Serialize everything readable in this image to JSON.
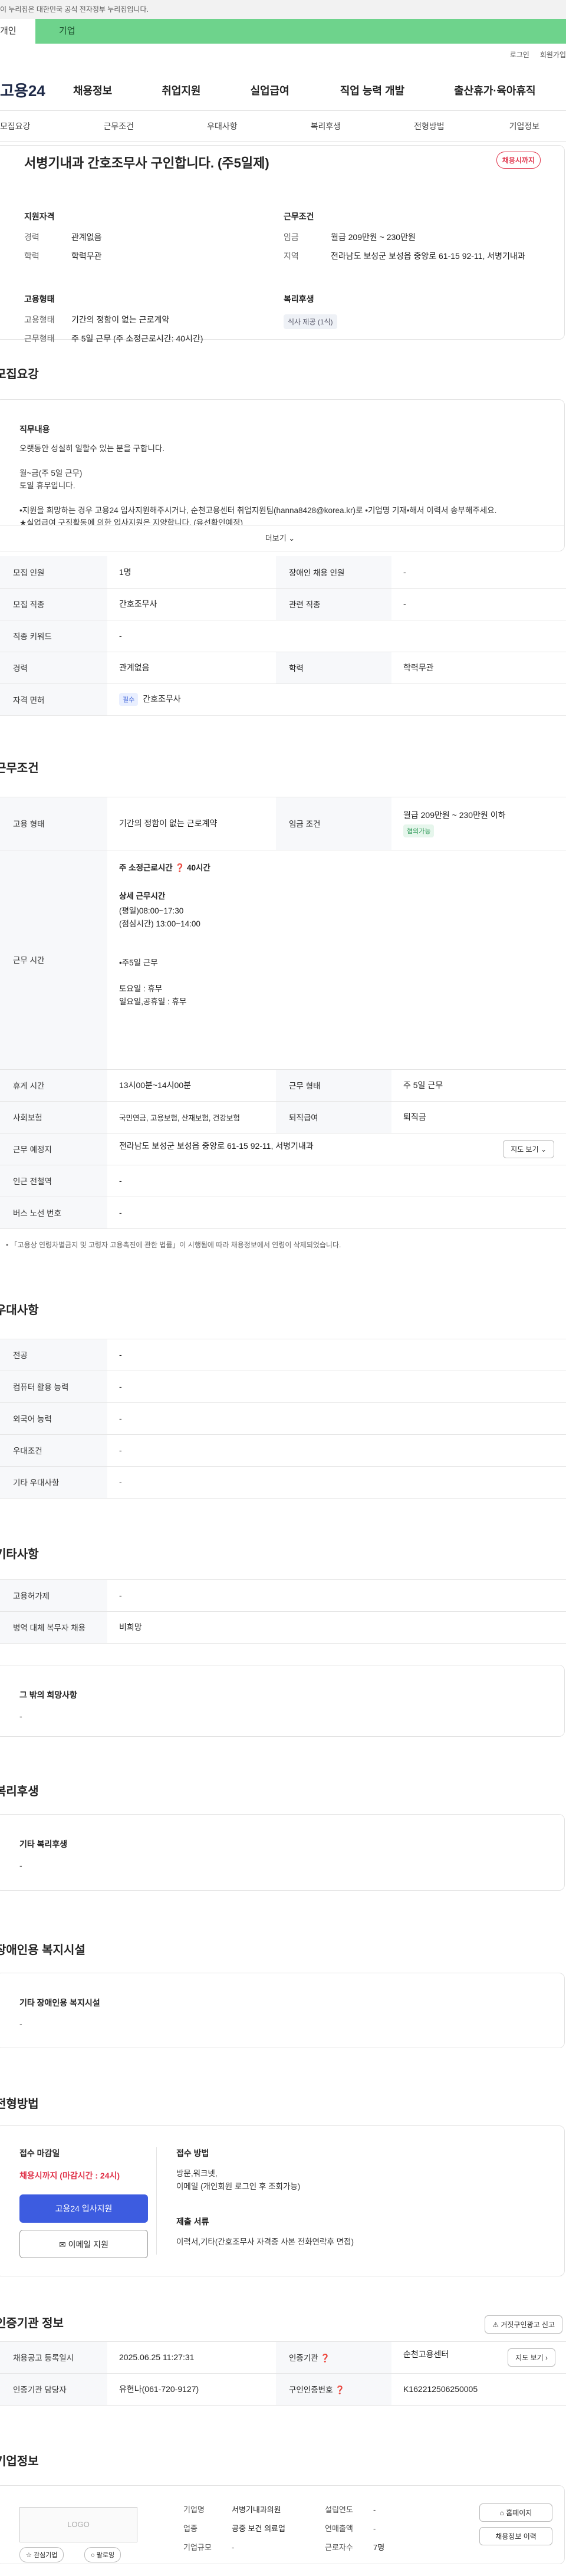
{
  "gov_banner": "이 누리집은 대한민국 공식 전자정부 누리집입니다.",
  "user_tabs": [
    "개인",
    "기업"
  ],
  "util_links": [
    "로그인",
    "회원가입"
  ],
  "logo": "고용24",
  "gnb": [
    "채용정보",
    "취업지원",
    "실업급여",
    "직업 능력 개발",
    "출산휴가·육아휴직"
  ],
  "subnav": [
    "모집요강",
    "근무조건",
    "우대사항",
    "복리후생",
    "전형방법",
    "기업정보"
  ],
  "header": {
    "title": "서병기내과 간호조무사 구인합니다. (주5일제)",
    "status": "채용시까지",
    "qual_title": "지원자격",
    "qual": [
      {
        "k": "경력",
        "v": "관계없음"
      },
      {
        "k": "학력",
        "v": "학력무관"
      }
    ],
    "cond_title": "근무조건",
    "cond": [
      {
        "k": "임금",
        "v": "월급 209만원 ~ 230만원"
      },
      {
        "k": "지역",
        "v": "전라남도 보성군 보성읍 중앙로 61-15 92-11, 서병기내과"
      }
    ],
    "emp_title": "고용형태",
    "emp": [
      {
        "k": "고용형태",
        "v": "기간의 정함이 없는 근로계약"
      },
      {
        "k": "근무형태",
        "v": "주 5일 근무 (주 소정근로시간: 40시간)"
      }
    ],
    "welfare_title": "복리후생",
    "welfare_chip": "식사 제공 (1식)"
  },
  "recruit": {
    "section_title": "모집요강",
    "duty_title": "직무내용",
    "duty_text": "오랫동안 성실히 일할수 있는 분을 구합니다.\n\n월~금(주 5일 근무)\n토일 휴무입니다.\n\n•지원을 희망하는 경우 고용24 입사지원해주시거나, 순천고용센터 취업지원팀(hanna8428@korea.kr)로 •기업명 기재•해서 이력서 송부해주세요.\n★실업급여 구직활동에 의한 입사지원은 지양합니다. (유선확인예정)\n(서류접계자에 한하여 개별연락 예정)",
    "more": "더보기",
    "rows": [
      {
        "k1": "모집 인원",
        "v1": "1명",
        "k2": "장애인 채용 인원",
        "v2": "-"
      },
      {
        "k1": "모집 직종",
        "v1": "간호조무사",
        "k2": "관련 직종",
        "v2": "-"
      },
      {
        "k1": "직종 키워드",
        "v1": "-"
      },
      {
        "k1": "경력",
        "v1": "관계없음",
        "k2": "학력",
        "v2": "학력무관"
      },
      {
        "k1": "자격 면허",
        "chip": "필수",
        "v1": "간호조무사"
      }
    ]
  },
  "work": {
    "section_title": "근무조건",
    "emp_k": "고용 형태",
    "emp_v": "기간의 정함이 없는 근로계약",
    "wage_k": "임금 조건",
    "wage_v": "월급 209만원 ~ 230만원 이하",
    "wage_chip": "협의가능",
    "time_k": "근무 시간",
    "time_hours": "주 소정근로시간 ❓ 40시간",
    "time_detail_title": "상세 근무시간",
    "time_detail": "(평일)08:00~17:30\n(점심시간) 13:00~14:00\n\n\n•주5일 근무\n\n토요일 : 휴무\n일요일,공휴일 : 휴무",
    "break_k": "휴게 시간",
    "break_v": "13시00분~14시00분",
    "type_k": "근무 형태",
    "type_v": "주 5일 근무",
    "ins_k": "사회보험",
    "ins_v": "국민연금, 고용보험, 산재보험, 건강보험",
    "retire_k": "퇴직급여",
    "retire_v": "퇴직금",
    "place_k": "근무 예정지",
    "place_v": "전라남도 보성군 보성읍 중앙로 61-15 92-11, 서병기내과",
    "map_btn": "지도 보기",
    "subway_k": "인근 전철역",
    "subway_v": "-",
    "bus_k": "버스 노선 번호",
    "bus_v": "-",
    "note": "• 「고용상 연령차별금지 및 고령자 고용촉진에 관한 법률」이 시행됨에 따라 채용정보에서 연령이 삭제되었습니다."
  },
  "pref": {
    "section_title": "우대사항",
    "rows": [
      {
        "k": "전공",
        "v": "-"
      },
      {
        "k": "컴퓨터 활용 능력",
        "v": "-"
      },
      {
        "k": "외국어 능력",
        "v": "-"
      },
      {
        "k": "우대조건",
        "v": "-"
      },
      {
        "k": "기타 우대사항",
        "v": "-"
      }
    ]
  },
  "etc": {
    "section_title": "기타사항",
    "rows": [
      {
        "k": "고용허가제",
        "v": "-"
      },
      {
        "k": "병역 대체 복무자 채용",
        "v": "비희망"
      }
    ],
    "box_title": "그 밖의 희망사항",
    "box_val": "-"
  },
  "welfare": {
    "section_title": "복리후생",
    "box_title": "기타 복리후생",
    "box_val": "-"
  },
  "disabled": {
    "section_title": "장애인용 복지시설",
    "box_title": "기타 장애인용 복지시설",
    "box_val": "-"
  },
  "screening": {
    "section_title": "전형방법",
    "deadline_title": "접수 마감일",
    "deadline": "채용시까지 (마감시간 : 24시)",
    "apply_btn": "고용24 입사지원",
    "email_btn": "이메일 지원",
    "method_title": "접수 방법",
    "method": "방문,워크넷,\n이메일 (개인회원 로그인 후 조회가능)",
    "docs_title": "제출 서류",
    "docs": "이력서,기타(간호조무사 자격증 사본 전화연락후 면접)"
  },
  "agency": {
    "section_title": "인증기관 정보",
    "report_btn": "거짓구인광고 신고",
    "reg_k": "채용공고 등록일시",
    "reg_v": "2025.06.25 11:27:31",
    "org_k": "인증기관 ❓",
    "org_v": "순천고용센터",
    "map_btn": "지도 보기",
    "mgr_k": "인증기관 담당자",
    "mgr_v": "유현나(061-720-9127)",
    "no_k": "구인인증번호 ❓",
    "no_v": "K162212506250005"
  },
  "company": {
    "section_title": "기업정보",
    "logo": "LOGO",
    "fav": "관심기업",
    "follow": "팔로잉",
    "name_k": "기업명",
    "name_v": "서병기내과의원",
    "est_k": "설립연도",
    "est_v": "-",
    "ind_k": "업종",
    "ind_v": "공중 보건 의료업",
    "sales_k": "연매출액",
    "sales_v": "-",
    "size_k": "기업규모",
    "size_v": "-",
    "emp_k": "근로자수",
    "emp_v": "7명",
    "home_btn": "홈페이지",
    "history_btn": "채용정보 이력"
  }
}
